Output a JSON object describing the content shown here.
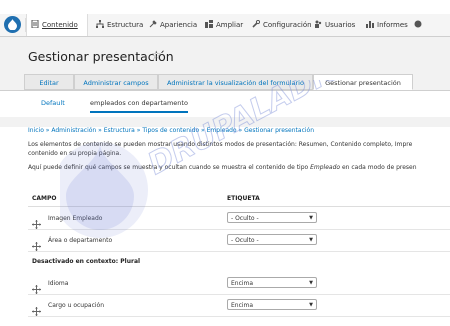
{
  "toolbar": {
    "items": [
      {
        "label": "Contenido",
        "icon": "content-icon"
      },
      {
        "label": "Estructura",
        "icon": "structure-icon"
      },
      {
        "label": "Apariencia",
        "icon": "appearance-icon"
      },
      {
        "label": "Ampliar",
        "icon": "extend-icon"
      },
      {
        "label": "Configuración",
        "icon": "wrench-icon"
      },
      {
        "label": "Usuarios",
        "icon": "people-icon"
      },
      {
        "label": "Informes",
        "icon": "reports-icon"
      }
    ]
  },
  "page": {
    "title": "Gestionar presentación"
  },
  "tabs": [
    "Editar",
    "Administrar campos",
    "Administrar la visualización del formulario",
    "Gestionar presentación"
  ],
  "subtabs": [
    "Default",
    "empleados con departamento"
  ],
  "breadcrumb": "Inicio » Administración » Estructura » Tipos de contenido » Empleado » Gestionar presentación",
  "description": {
    "line1": "Los elementos de contenido se pueden mostrar usando distintos modos de presentación: Resumen, Contenido completo, Impre",
    "line2": "contenido en su propia página.",
    "line3_pre": "Aquí puede definir qué campos se muestra y ocultan cuando se muestra el contenido de tipo ",
    "line3_em": "Empleado",
    "line3_post": " en cada modo de presen"
  },
  "table": {
    "col_field": "CAMPO",
    "col_label": "ETIQUETA",
    "rows_top": [
      {
        "field": "Imagen Empleado",
        "label": "- Oculto -"
      },
      {
        "field": "Área o departamento",
        "label": "- Oculto -"
      }
    ],
    "region_disabled": "Desactivado en contexto: Plural",
    "rows_bottom": [
      {
        "field": "Idioma",
        "label": "Encima"
      },
      {
        "field": "Cargo u ocupación",
        "label": "Encima"
      }
    ]
  },
  "watermark": "DRUPALADICTO"
}
